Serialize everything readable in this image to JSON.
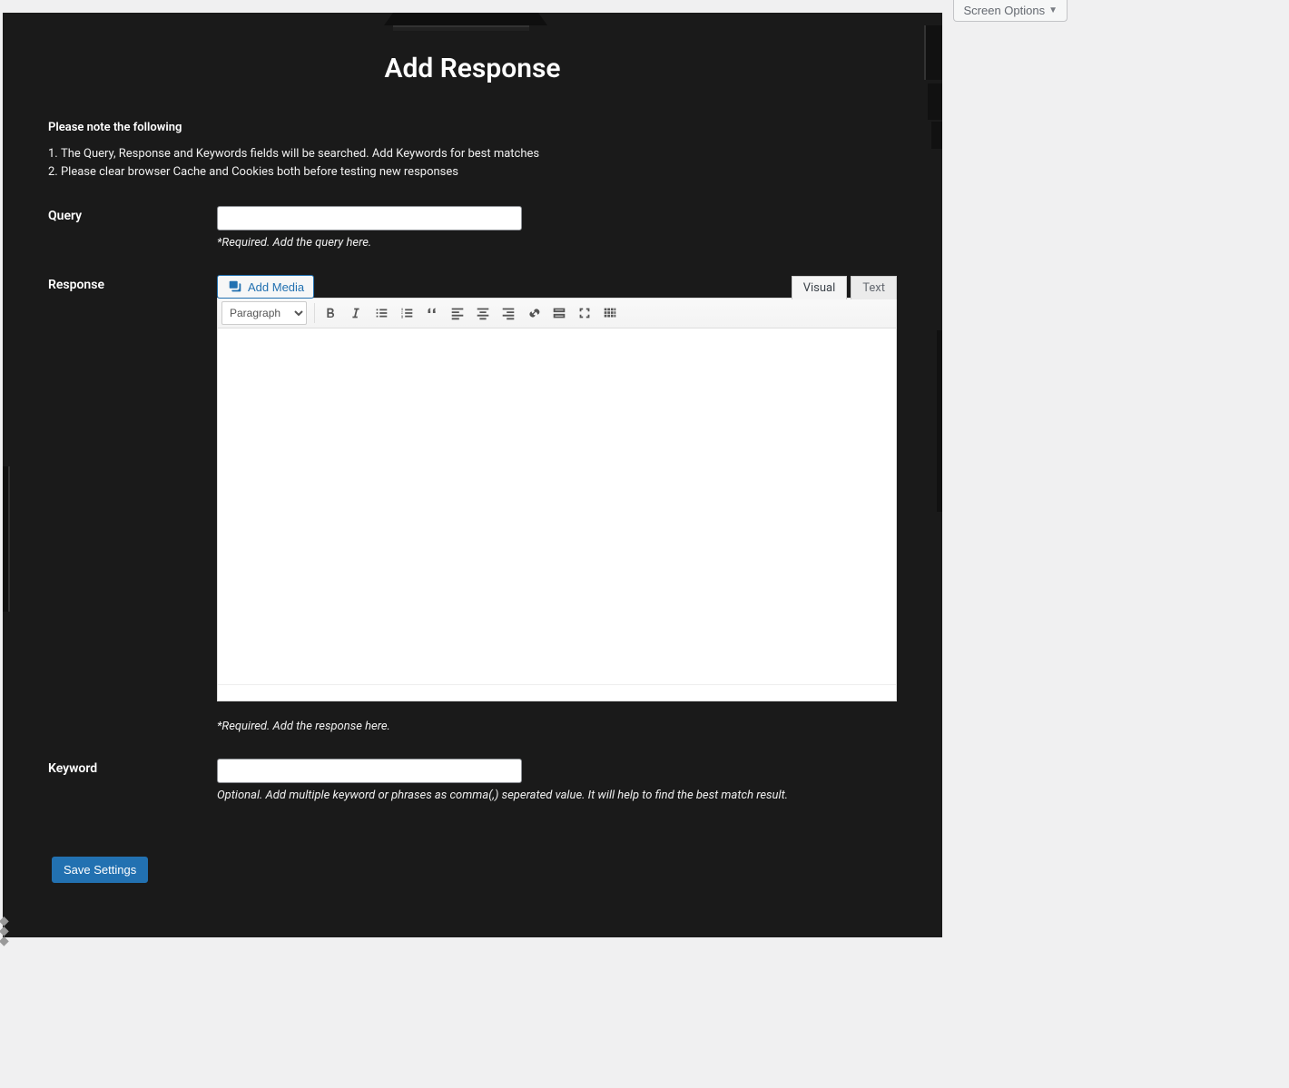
{
  "screen_options_label": "Screen Options",
  "page_title": "Add Response",
  "note_heading": "Please note the following",
  "notes": [
    "The Query, Response and Keywords fields will be searched. Add Keywords for best matches",
    "Please clear browser Cache and Cookies both before testing new responses"
  ],
  "query": {
    "label": "Query",
    "value": "",
    "help": "*Required. Add the query here."
  },
  "response": {
    "label": "Response",
    "add_media_label": "Add Media",
    "tabs": {
      "visual": "Visual",
      "text": "Text"
    },
    "format_selected": "Paragraph",
    "help": "*Required. Add the response here."
  },
  "keyword": {
    "label": "Keyword",
    "value": "",
    "help": "Optional. Add multiple keyword or phrases as comma(,) seperated value. It will help to find the best match result."
  },
  "save_label": "Save Settings"
}
